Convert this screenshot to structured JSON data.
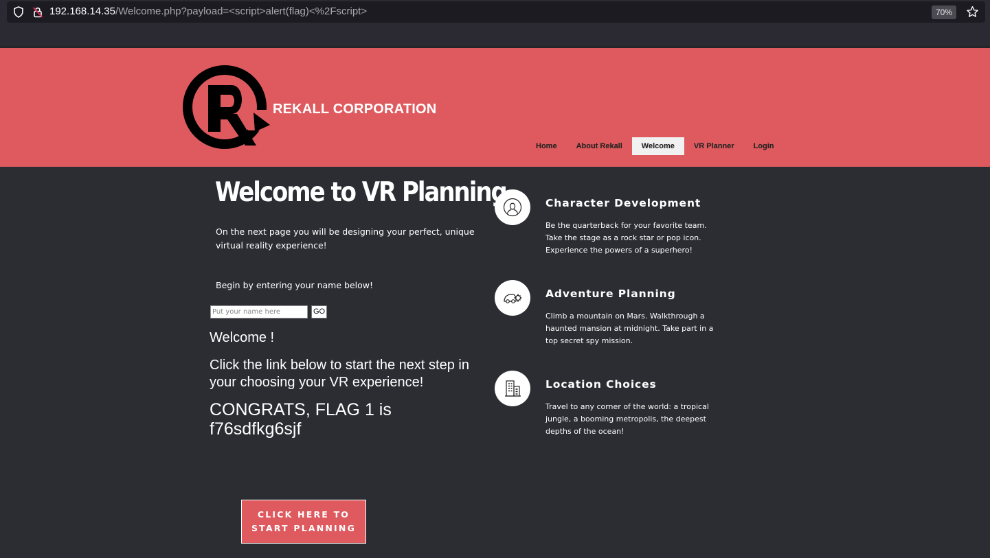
{
  "browser": {
    "url_host": "192.168.14.35",
    "url_path": "/Welcome.php?payload=<script>alert(flag)<%2Fscript>",
    "zoom": "70%"
  },
  "header": {
    "brand": "REKALL CORPORATION",
    "nav": [
      {
        "label": "Home",
        "active": false
      },
      {
        "label": "About Rekall",
        "active": false
      },
      {
        "label": "Welcome",
        "active": true
      },
      {
        "label": "VR Planner",
        "active": false
      },
      {
        "label": "Login",
        "active": false
      }
    ]
  },
  "main": {
    "title": "Welcome to VR Planning",
    "intro": "On the next  page you will be designing your perfect, unique virtual reality experience!",
    "begin": "Begin by entering your name below!",
    "name_placeholder": "Put your name here",
    "go_label": "GO",
    "welcome_message": "Welcome !",
    "next_step": "Click the link below to start the next step in your choosing your VR experience!",
    "flag_line1": "CONGRATS, FLAG 1 is",
    "flag_line2": "f76sdfkg6sjf",
    "cta_line1": "CLICK HERE TO",
    "cta_line2": "START PLANNING"
  },
  "features": [
    {
      "icon": "person-icon",
      "title": "Character Development",
      "description": "Be the quarterback for your favorite team. Take the stage as a rock star or pop icon. Experience the powers of a superhero!"
    },
    {
      "icon": "vehicle-icon",
      "title": "Adventure Planning",
      "description": "Climb a mountain on Mars. Walkthrough a haunted mansion at midnight. Take part in a top secret spy mission."
    },
    {
      "icon": "buildings-icon",
      "title": "Location Choices",
      "description": "Travel to any corner of the world: a tropical jungle, a booming metropolis, the deepest depths of the ocean!"
    }
  ],
  "colors": {
    "header_bg": "#de5a5e",
    "page_bg": "#2b2d33",
    "accent": "#de5a5e"
  }
}
